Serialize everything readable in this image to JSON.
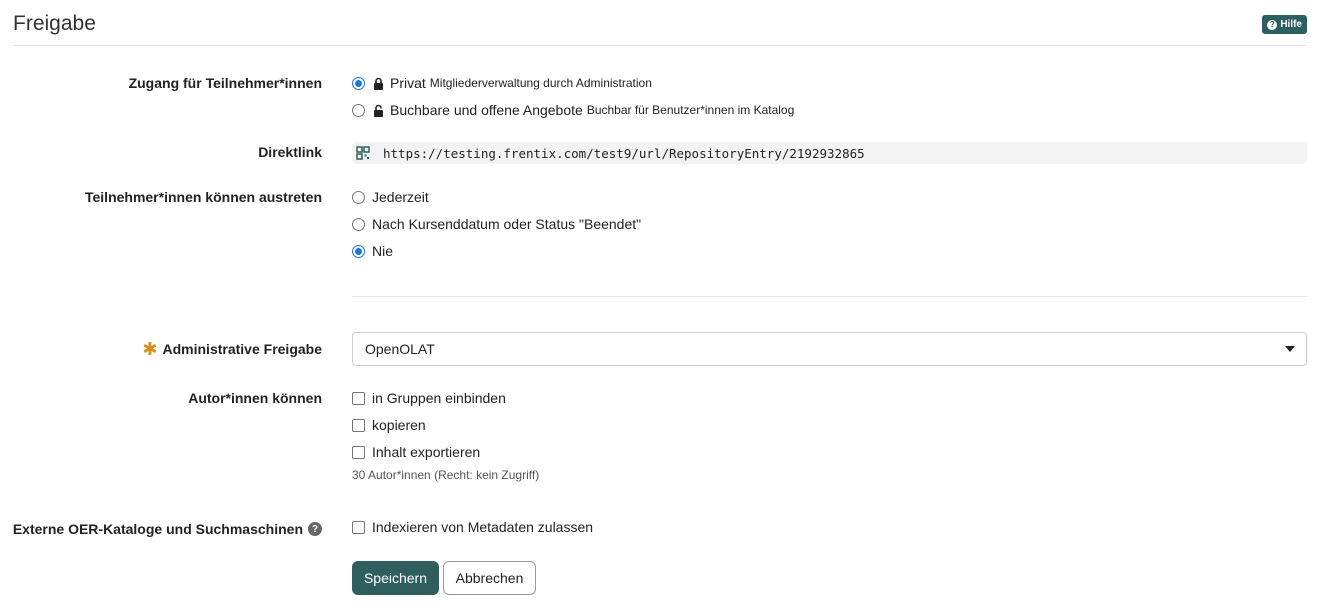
{
  "header": {
    "title": "Freigabe",
    "help_label": "Hilfe"
  },
  "access": {
    "label": "Zugang für Teilnehmer*innen",
    "options": [
      {
        "label": "Privat",
        "hint": "Mitgliederverwaltung durch Administration",
        "checked": true,
        "icon": "lock-icon"
      },
      {
        "label": "Buchbare und offene Angebote",
        "hint": "Buchbar für Benutzer*innen im Katalog",
        "checked": false,
        "icon": "unlock-icon"
      }
    ]
  },
  "directlink": {
    "label": "Direktlink",
    "url": "https://testing.frentix.com/test9/url/RepositoryEntry/2192932865",
    "icon": "qr-code-icon"
  },
  "leave": {
    "label": "Teilnehmer*innen können austreten",
    "options": [
      {
        "label": "Jederzeit",
        "checked": false
      },
      {
        "label": "Nach Kursenddatum oder Status \"Beendet\"",
        "checked": false
      },
      {
        "label": "Nie",
        "checked": true
      }
    ]
  },
  "admin_release": {
    "required_mark": "✱",
    "label": "Administrative Freigabe",
    "selected": "OpenOLAT"
  },
  "authors": {
    "label": "Autor*innen können",
    "options": [
      {
        "label": "in Gruppen einbinden",
        "checked": false
      },
      {
        "label": "kopieren",
        "checked": false
      },
      {
        "label": "Inhalt exportieren",
        "checked": false
      }
    ],
    "note": "30 Autor*innen (Recht: kein Zugriff)"
  },
  "oer": {
    "label": "Externe OER-Kataloge und Suchmaschinen",
    "info_icon": "?",
    "option": {
      "label": "Indexieren von Metadaten zulassen",
      "checked": false
    }
  },
  "buttons": {
    "save": "Speichern",
    "cancel": "Abbrechen"
  },
  "colors": {
    "primary": "#2e5e5e",
    "radio_checked": "#1a73e8",
    "required": "#d98c1e"
  }
}
